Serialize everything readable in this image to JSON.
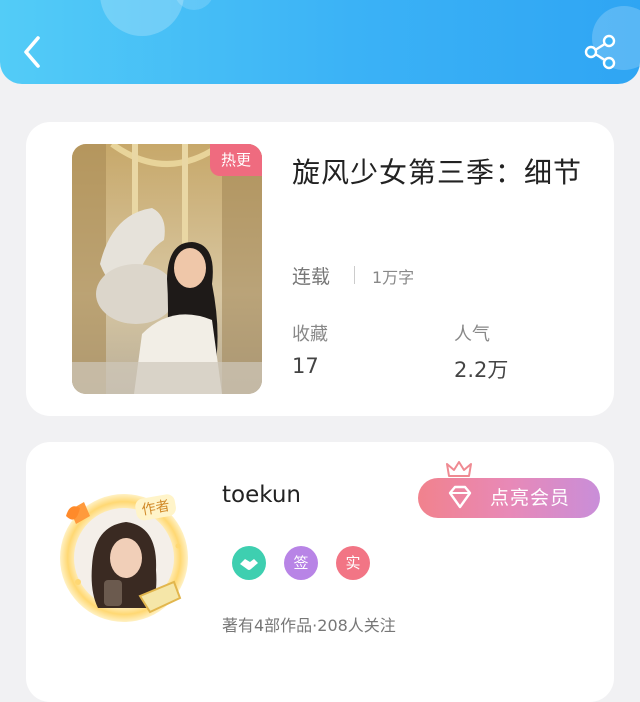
{
  "header": {
    "back_icon": "chevron-left-icon",
    "share_icon": "share-icon",
    "gradient": [
      "#53ccf7",
      "#2fa5f3"
    ]
  },
  "book": {
    "tag": "热更",
    "title": "旋风少女第三季：细节",
    "status": "连载",
    "word_count": "1万字",
    "stats": [
      {
        "label": "收藏",
        "value": "17"
      },
      {
        "label": "人气",
        "value": "2.2万"
      }
    ]
  },
  "author": {
    "name": "toekun",
    "avatar_badge_text": "作者",
    "vip_button_label": "点亮会员",
    "badges": [
      {
        "icon": "handshake-icon",
        "text": "",
        "color": "#3ecfb0"
      },
      {
        "icon": "signed-badge",
        "text": "签",
        "color": "#b884e6"
      },
      {
        "icon": "verified-badge",
        "text": "实",
        "color": "#f27585"
      }
    ],
    "works_summary": "著有4部作品·208人关注"
  },
  "colors": {
    "background": "#f1f1f3",
    "hot_tag": "#ef6b7f",
    "vip_gradient": [
      "#f1828d",
      "#c98ed9"
    ]
  }
}
